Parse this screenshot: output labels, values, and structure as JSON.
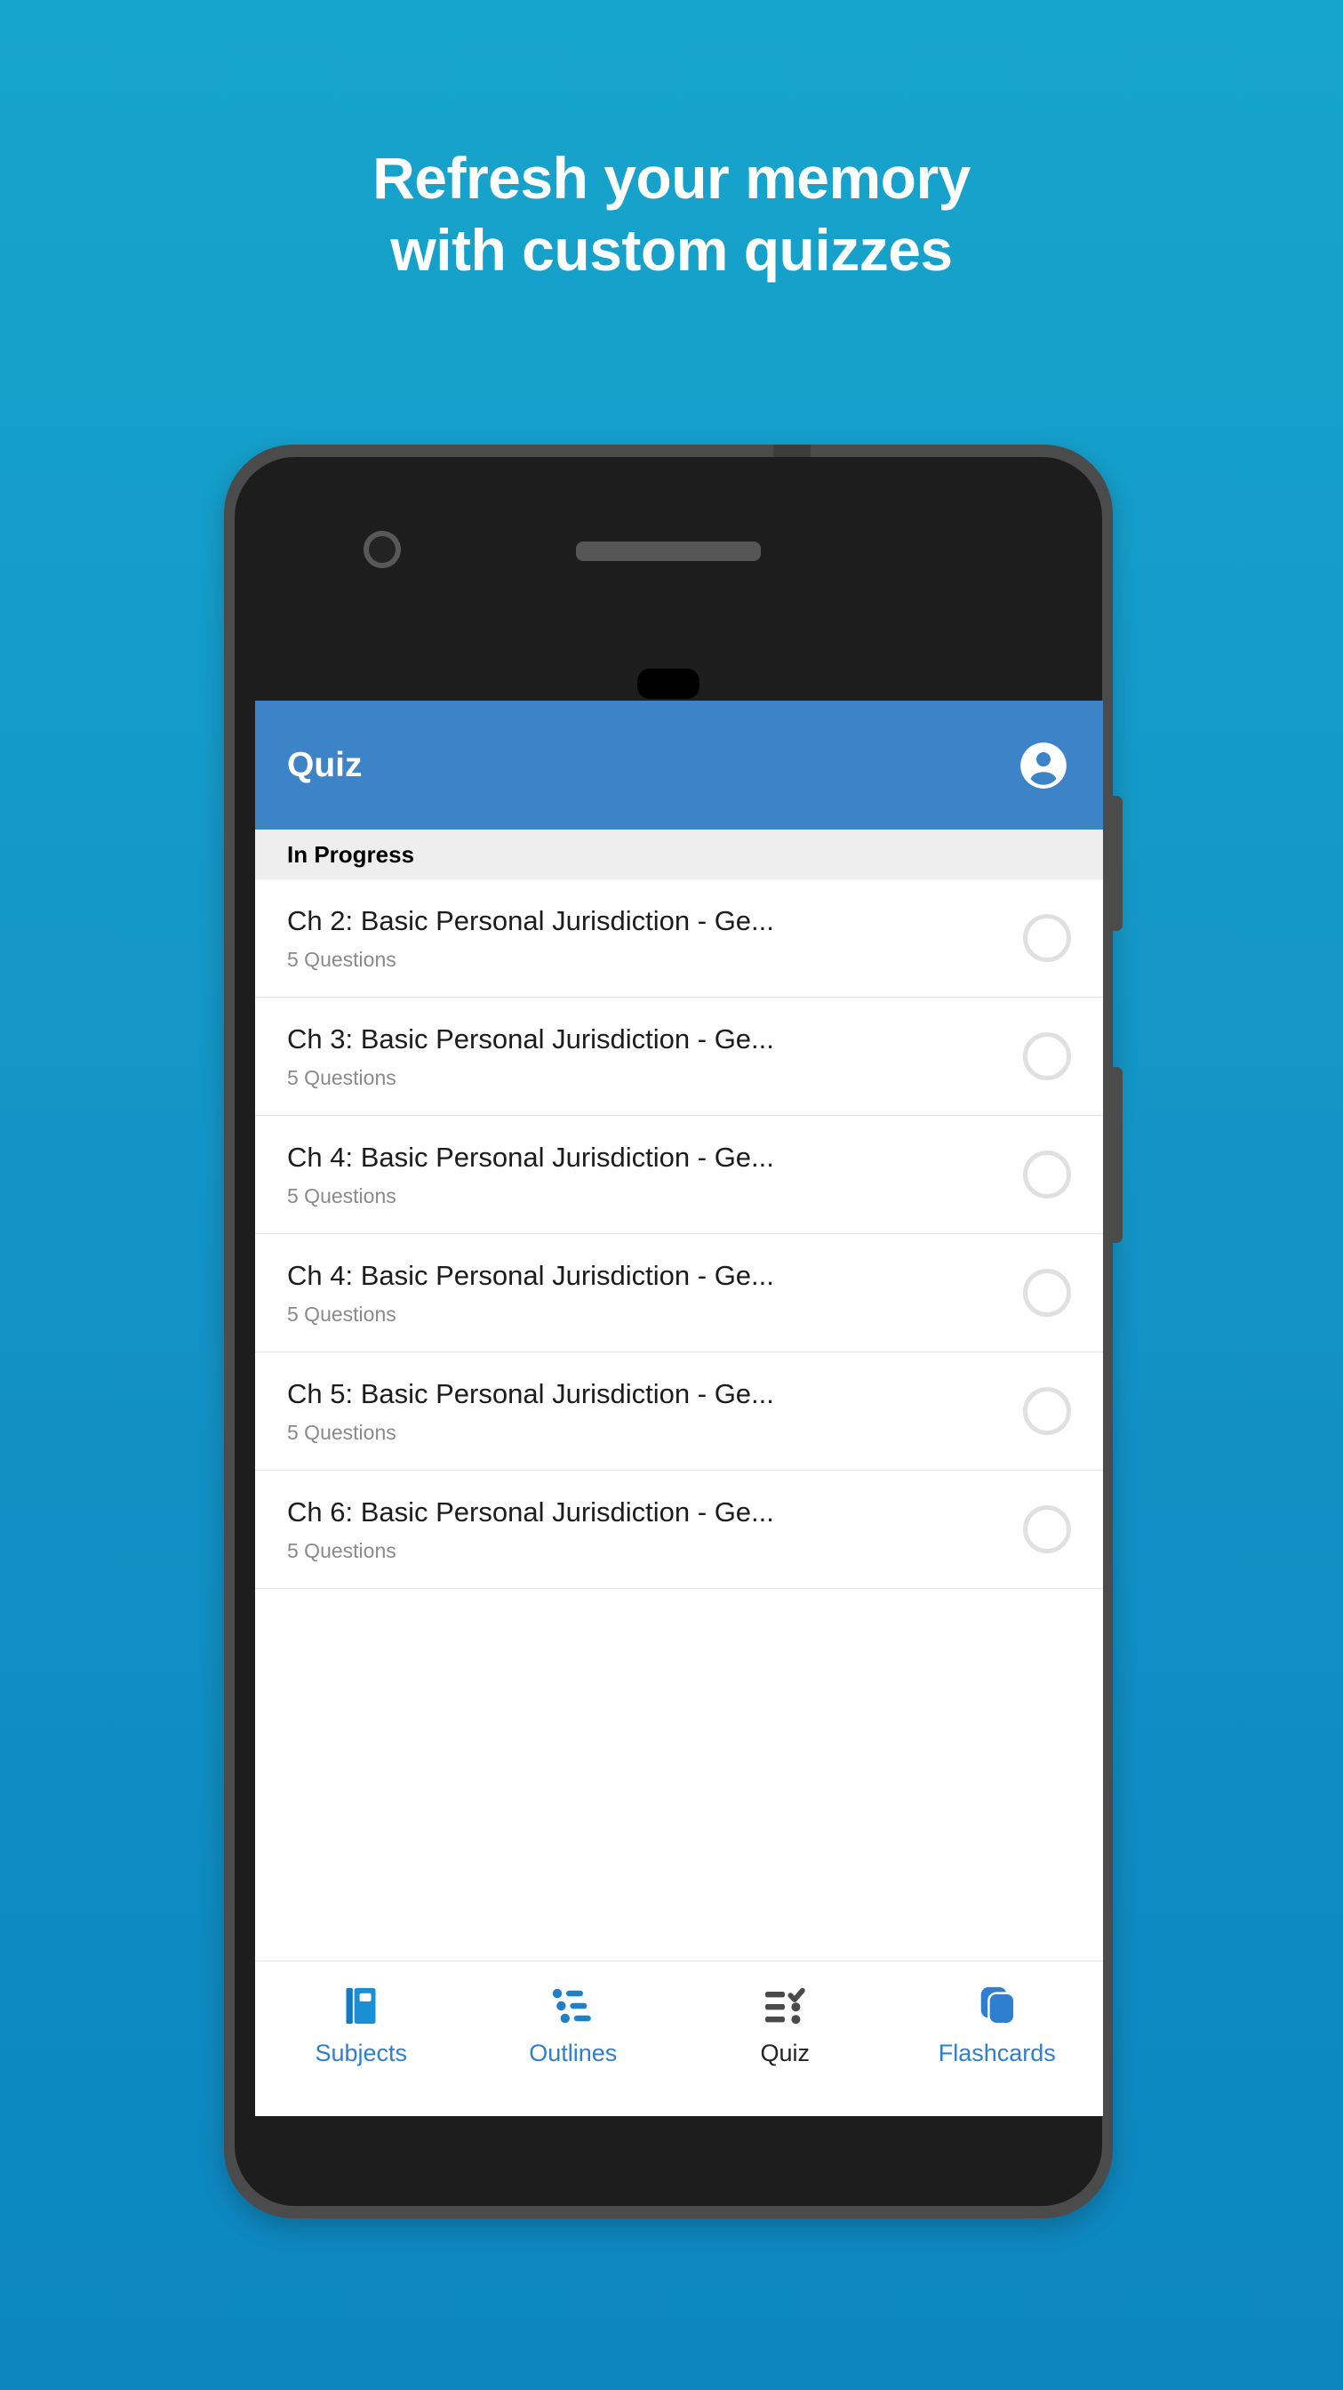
{
  "promo": {
    "headline_line1": "Refresh your memory",
    "headline_line2": "with custom quizzes",
    "background_top_color": "#17a4cc",
    "background_bottom_color": "#0d86bf"
  },
  "app": {
    "appbar": {
      "title": "Quiz",
      "background_color": "#3c83c8",
      "account_icon": "account-circle-icon"
    },
    "section_header": {
      "label": "In Progress",
      "background_color": "#eeeeee"
    },
    "quiz_list": [
      {
        "title": "Ch 2: Basic Personal Jurisdiction - Ge...",
        "subtitle": "5 Questions",
        "status_indicator": "empty-circle"
      },
      {
        "title": "Ch 3: Basic Personal Jurisdiction - Ge...",
        "subtitle": "5 Questions",
        "status_indicator": "empty-circle"
      },
      {
        "title": "Ch 4: Basic Personal Jurisdiction - Ge...",
        "subtitle": "5 Questions",
        "status_indicator": "empty-circle"
      },
      {
        "title": "Ch 4: Basic Personal Jurisdiction - Ge...",
        "subtitle": "5 Questions",
        "status_indicator": "empty-circle"
      },
      {
        "title": "Ch 5: Basic Personal Jurisdiction - Ge...",
        "subtitle": "5 Questions",
        "status_indicator": "empty-circle"
      },
      {
        "title": "Ch 6: Basic Personal Jurisdiction - Ge...",
        "subtitle": "5 Questions",
        "status_indicator": "empty-circle"
      }
    ],
    "bottom_nav": {
      "active_color": "#232323",
      "inactive_color": "#2f7fd0",
      "items": [
        {
          "label": "Subjects",
          "icon": "book-icon",
          "active": false
        },
        {
          "label": "Outlines",
          "icon": "outline-list-icon",
          "active": false
        },
        {
          "label": "Quiz",
          "icon": "checklist-icon",
          "active": true
        },
        {
          "label": "Flashcards",
          "icon": "cards-stack-icon",
          "active": false
        }
      ]
    }
  }
}
